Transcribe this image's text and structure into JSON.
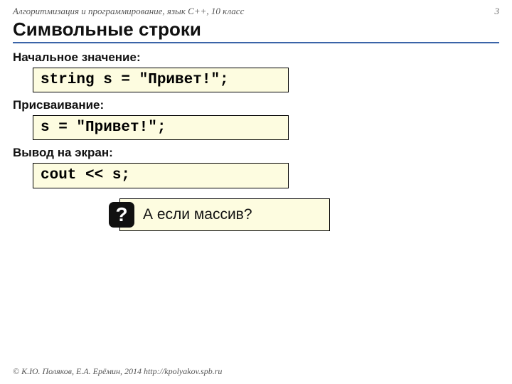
{
  "header": {
    "course": "Алгоритмизация и программирование, язык C++, 10 класс",
    "page_number": "3"
  },
  "title": "Символьные строки",
  "sections": [
    {
      "label": "Начальное значение:",
      "code": "string s = \"Привет!\";"
    },
    {
      "label": "Присваивание:",
      "code": "s = \"Привет!\";"
    },
    {
      "label": "Вывод на экран:",
      "code": "cout << s;"
    }
  ],
  "callout": {
    "symbol": "?",
    "text": "А если массив?"
  },
  "footer": "© К.Ю. Поляков, Е.А. Ерёмин, 2014   http://kpolyakov.spb.ru"
}
